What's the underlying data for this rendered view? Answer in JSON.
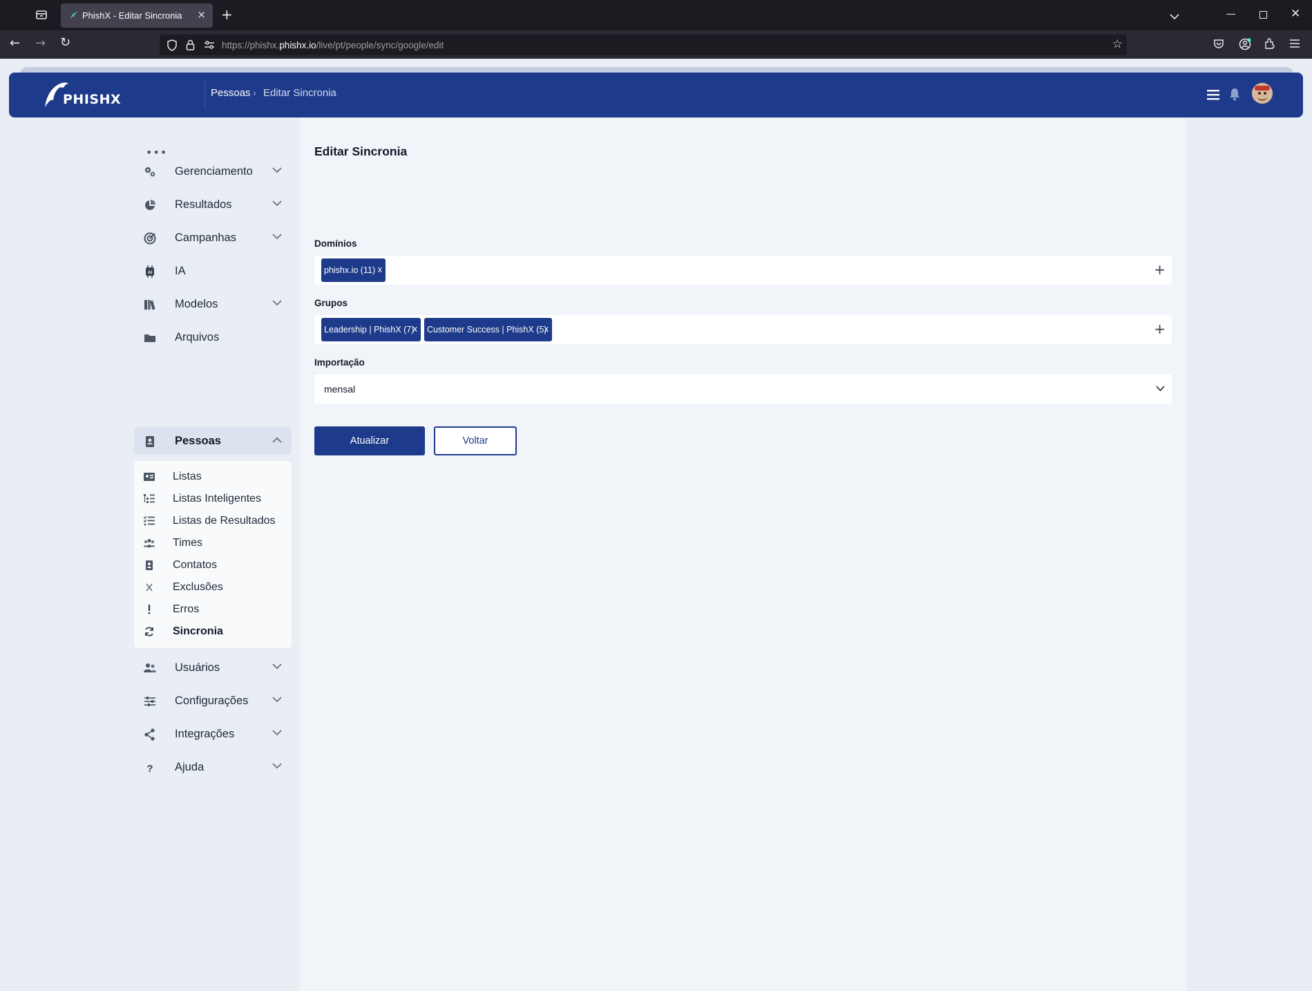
{
  "browser": {
    "tab_title": "PhishX - Editar Sincronia",
    "url_prefix": "https://phishx.",
    "url_domain": "phishx.io",
    "url_path": "/live/pt/people/sync/google/edit"
  },
  "header": {
    "logo_text": "PHISHX",
    "breadcrumb": [
      "Pessoas",
      "Editar Sincronia"
    ]
  },
  "sidebar": {
    "more": "•••",
    "items_top": [
      {
        "label": "Gerenciamento",
        "icon": "gears-icon",
        "expandable": true
      },
      {
        "label": "Resultados",
        "icon": "pie-chart-icon",
        "expandable": true
      },
      {
        "label": "Campanhas",
        "icon": "target-icon",
        "expandable": true
      },
      {
        "label": "IA",
        "icon": "ai-chip-icon",
        "expandable": false
      },
      {
        "label": "Modelos",
        "icon": "books-icon",
        "expandable": true
      },
      {
        "label": "Arquivos",
        "icon": "folder-icon",
        "expandable": false
      },
      {
        "label": "Pessoas",
        "icon": "address-book-icon",
        "expandable": true,
        "expanded": true
      }
    ],
    "submenu": [
      {
        "label": "Listas",
        "icon": "id-card-icon"
      },
      {
        "label": "Listas Inteligentes",
        "icon": "list-tree-icon"
      },
      {
        "label": "Listas de Resultados",
        "icon": "list-check-icon"
      },
      {
        "label": "Times",
        "icon": "people-group-icon"
      },
      {
        "label": "Contatos",
        "icon": "contact-icon"
      },
      {
        "label": "Exclusões",
        "icon": "x-icon"
      },
      {
        "label": "Erros",
        "icon": "exclamation-icon"
      },
      {
        "label": "Sincronia",
        "icon": "sync-icon",
        "active": true
      }
    ],
    "items_bottom": [
      {
        "label": "Usuários",
        "icon": "users-icon"
      },
      {
        "label": "Configurações",
        "icon": "sliders-icon"
      },
      {
        "label": "Integrações",
        "icon": "share-nodes-icon"
      },
      {
        "label": "Ajuda",
        "icon": "question-icon"
      }
    ]
  },
  "form": {
    "title": "Editar Sincronia",
    "domains_label": "Domínios",
    "domains": [
      "phishx.io (11)"
    ],
    "groups_label": "Grupos",
    "groups": [
      "Leadership | PhishX (7)",
      "Customer Success | PhishX (5)"
    ],
    "chip_remove": "x",
    "import_label": "Importação",
    "import_value": "mensal",
    "submit_label": "Atualizar",
    "back_label": "Voltar"
  },
  "colors": {
    "brand": "#1e3a8a",
    "page_bg": "#e9eef5",
    "panel_bg": "#f1f5f9"
  }
}
